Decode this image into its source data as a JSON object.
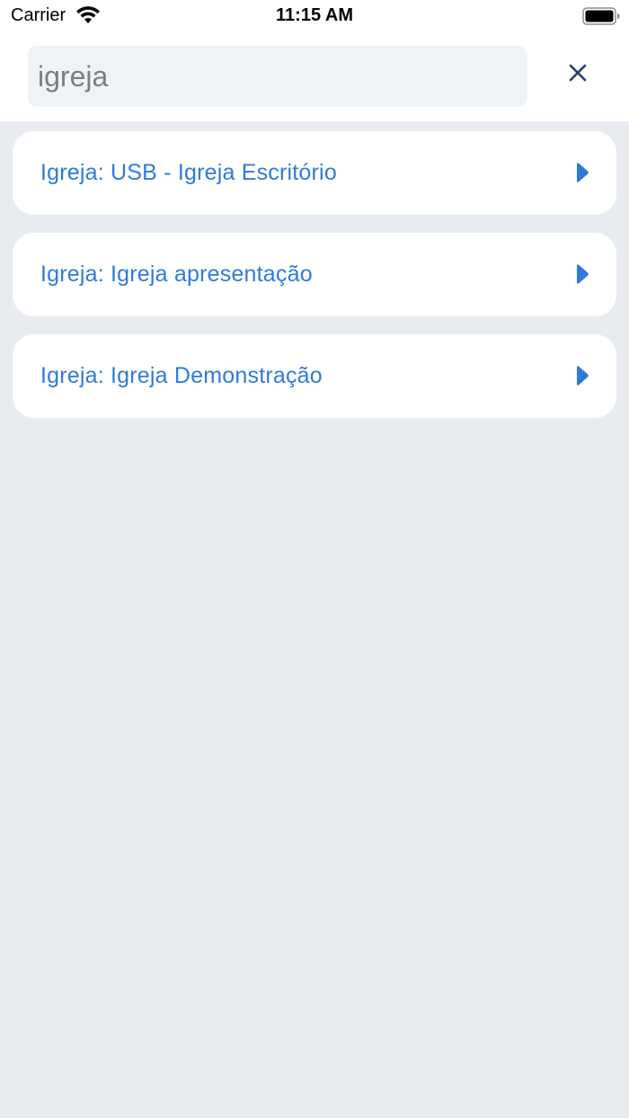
{
  "status_bar": {
    "carrier": "Carrier",
    "time": "11:15 AM",
    "icons": [
      "wifi-icon",
      "battery-icon"
    ]
  },
  "search": {
    "value": "igreja",
    "close_icon": "close-icon"
  },
  "results": [
    {
      "label": "Igreja: USB - Igreja Escritório",
      "icon": "chevron-right-icon"
    },
    {
      "label": "Igreja: Igreja apresentação",
      "icon": "chevron-right-icon"
    },
    {
      "label": "Igreja: Igreja Demonstração",
      "icon": "chevron-right-icon"
    }
  ],
  "colors": {
    "accent": "#2e7bd9",
    "icon_dark": "#1f3f66",
    "background": "#e8ecf0",
    "card": "#ffffff"
  }
}
